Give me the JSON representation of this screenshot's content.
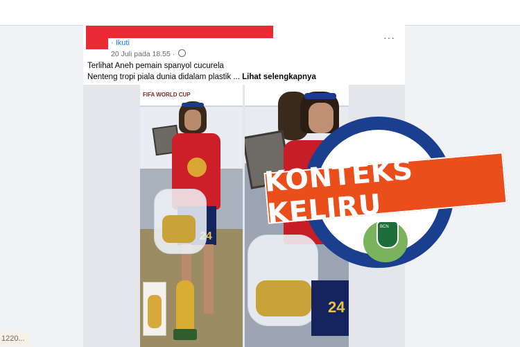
{
  "post": {
    "follow_label": "· Ikuti",
    "timestamp": "20 Juli pada 18.55 ·",
    "more_label": "···",
    "caption_line1": "Terlihat Aneh pemain spanyol cucurela",
    "caption_line2": "Nenteng tropi piala dunia didalam plastik ...",
    "see_more": "Lihat selengkapnya"
  },
  "photos": {
    "left_banner_text": "FIFA WORLD CUP",
    "left_jersey_number": "24",
    "right_jersey_number": "24"
  },
  "stamp": {
    "label": "KONTEKS KELIRU",
    "logo_text": "BCN",
    "accent_color": "#e94e1b",
    "ring_color": "#1b3f8f"
  },
  "sidebar": {
    "chip_text": "1220..."
  }
}
